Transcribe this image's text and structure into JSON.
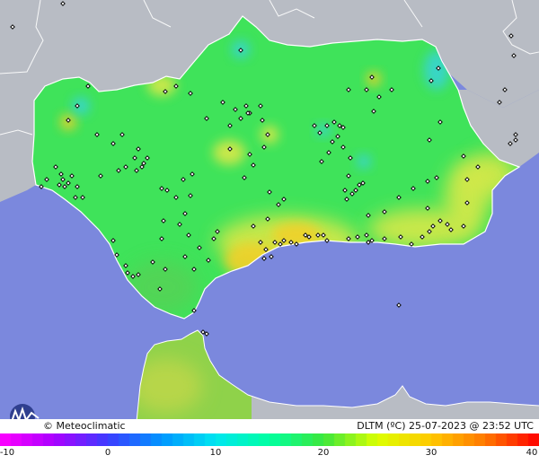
{
  "footer": {
    "brand": "© Meteoclimatic",
    "variable": "DLTM (ºC)",
    "date": "25-07-2023",
    "at": "@",
    "time": "23:52 UTC"
  },
  "colorbar": {
    "min": -10,
    "max": 40,
    "ticks": [
      -10,
      0,
      10,
      20,
      30,
      40
    ],
    "tick_labels": [
      "-10",
      "0",
      "10",
      "20",
      "30",
      "40"
    ]
  },
  "colors": {
    "sea": "#7b88dd",
    "outside_land": "#b8bcc4",
    "region_main": "#3fe35a",
    "warm_coast": "#d7e84a",
    "hot_spot": "#f0d02a",
    "cool_spot": "#38d3d9",
    "north_africa": "#8fd24a"
  },
  "icons": {
    "logo": "meteoclimatic-logo-icon",
    "station_marker": "station-diamond-icon"
  }
}
